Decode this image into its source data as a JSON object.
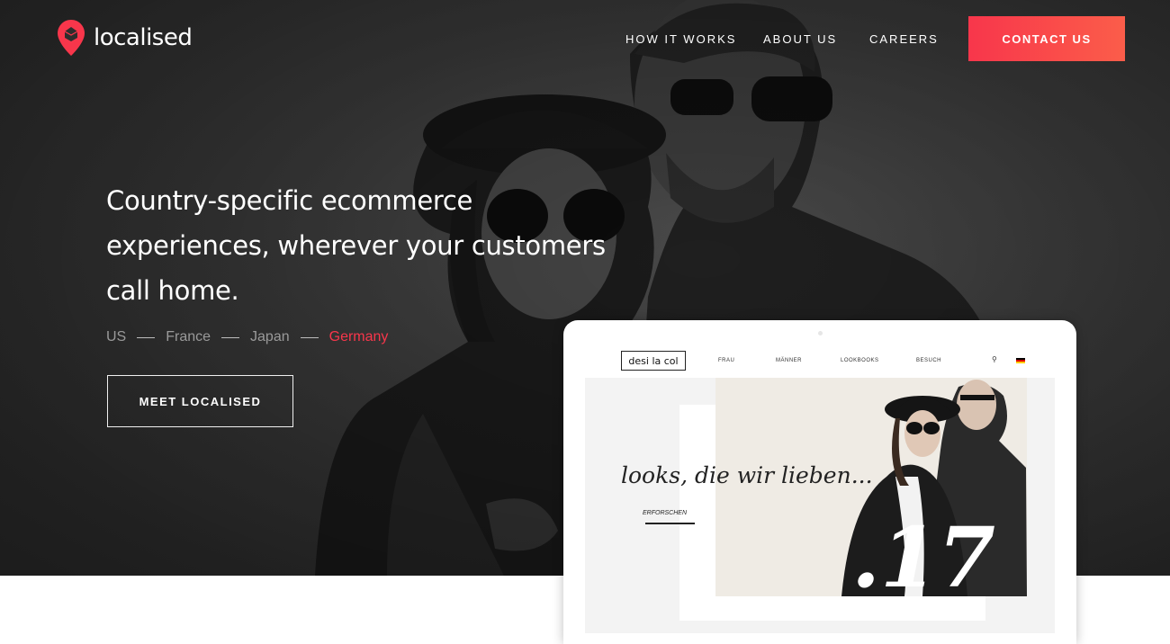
{
  "brand": {
    "name": "localised",
    "logo_icon": "map-pin-icon",
    "accent_color": "#f8364b"
  },
  "nav": {
    "items": [
      {
        "label": "HOW IT WORKS"
      },
      {
        "label": "ABOUT US"
      },
      {
        "label": "CAREERS"
      }
    ],
    "cta_label": "CONTACT US"
  },
  "hero": {
    "headline_lines": [
      "Country-specific ecommerce",
      "experiences, wherever your customers",
      "call home."
    ],
    "countries": [
      "US",
      "France",
      "Japan",
      "Germany"
    ],
    "active_country": "Germany",
    "cta_label": "MEET LOCALISED"
  },
  "mockup": {
    "store_logo": "desi la col",
    "nav_items": [
      "FRAU",
      "MÄNNER",
      "LOOKBOOKS",
      "BESUCH"
    ],
    "search_icon": "search-icon",
    "flag_icon": "germany-flag-icon",
    "tagline": "looks, die wir lieben...",
    "explore_label": "ERFORSCHEN",
    "season_number": ".17"
  }
}
